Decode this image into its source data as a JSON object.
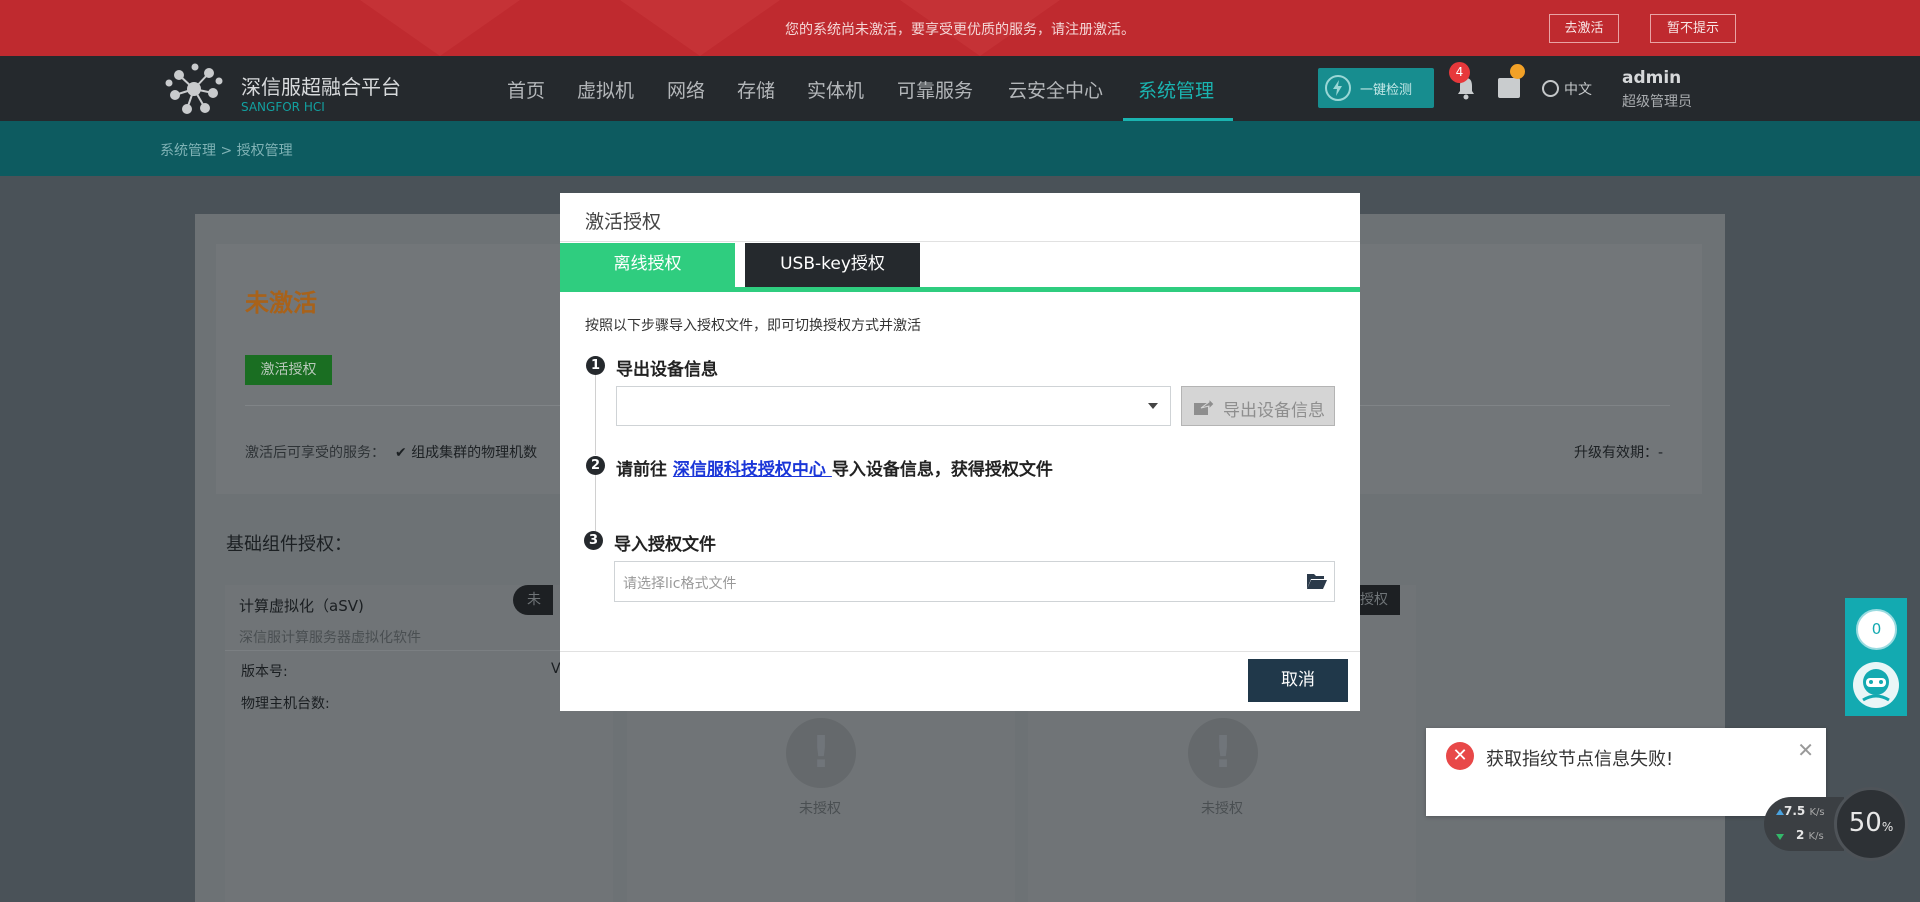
{
  "notice": {
    "text": "您的系统尚未激活，要享受更优质的服务，请注册激活。",
    "activate_btn": "去激活",
    "dismiss_btn": "暂不提示"
  },
  "header": {
    "logo_title": "深信服超融合平台",
    "logo_sub": "SANGFOR HCI",
    "nav": [
      "首页",
      "虚拟机",
      "网络",
      "存储",
      "实体机",
      "可靠服务",
      "云安全中心",
      "系统管理"
    ],
    "active_nav": "系统管理",
    "check_btn": "一键检测",
    "notification_count": "4",
    "language": "中文",
    "user_name": "admin",
    "user_role": "超级管理员",
    "accent_color": "#1ab4b0"
  },
  "breadcrumb": "系统管理  >  授权管理",
  "background": {
    "status_title": "未激活",
    "activate_btn": "激活授权",
    "services_label": "激活后可享受的服务：",
    "service_item": "组成集群的物理机数",
    "upgrade_label": "升级有效期：-",
    "basic_title": "基础组件授权：",
    "components": [
      {
        "name": "计算虚拟化（aSV)",
        "desc": "深信服计算服务器虚拟化软件",
        "tag": "未"
      },
      {
        "name": "",
        "desc": "",
        "tag": ""
      },
      {
        "name": "",
        "desc": "",
        "tag": "授权"
      }
    ],
    "version_label": "版本号:",
    "version_value": "V",
    "hosts_label": "物理主机台数:",
    "unauthorized": "未授权"
  },
  "modal": {
    "title": "激活授权",
    "tabs": [
      "离线授权",
      "USB-key授权"
    ],
    "active_tab": "离线授权",
    "intro": "按照以下步骤导入授权文件，即可切换授权方式并激活",
    "step1": {
      "num": "1",
      "title": "导出设备信息",
      "select_value": "",
      "export_btn": "导出设备信息"
    },
    "step2": {
      "num": "2",
      "prefix": "请前往 ",
      "link": "深信服科技授权中心 ",
      "suffix": "导入设备信息，获得授权文件"
    },
    "step3": {
      "num": "3",
      "title": "导入授权文件",
      "placeholder": "请选择lic格式文件"
    },
    "cancel_btn": "取消",
    "tab_color": "#2fcd7f"
  },
  "toast": {
    "message": "获取指纹节点信息失败!",
    "type": "error",
    "color": "#e84848"
  },
  "float_widget": {
    "count": "0"
  },
  "speed": {
    "up_value": "7.5",
    "up_unit": "K/s",
    "down_value": "2",
    "down_unit": "K/s",
    "gauge_value": "50",
    "gauge_unit": "%"
  }
}
